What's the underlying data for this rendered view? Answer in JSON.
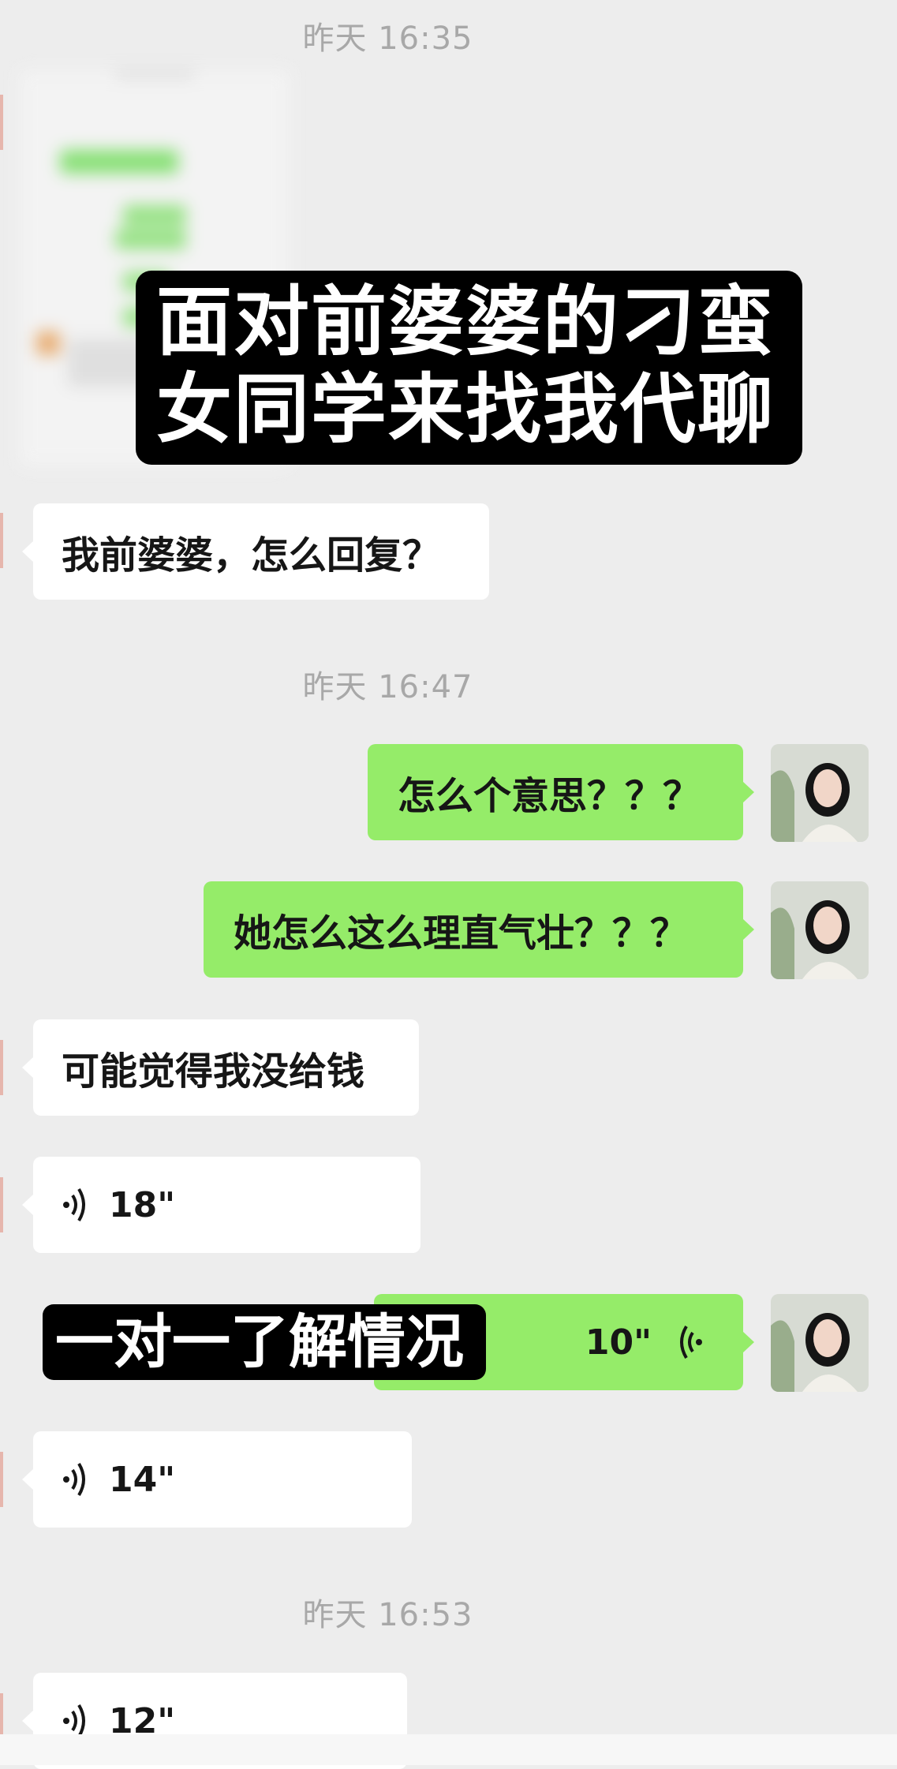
{
  "timestamps": [
    "昨天 16:35",
    "昨天 16:47",
    "昨天 16:53"
  ],
  "overlay_titles": {
    "line1": "面对前婆婆的刁蛮",
    "line2": "女同学来找我代聊",
    "mid": "一对一了解情况"
  },
  "messages": {
    "m1": "我前婆婆，怎么回复？",
    "m2": "怎么个意思？？？",
    "m3": "她怎么这么理直气壮？？？",
    "m4": "可能觉得我没给钱",
    "v1": "18\"",
    "v2": "10\"",
    "v3": "14\"",
    "v4": "12\""
  },
  "icons": {
    "voice_in": "voice-wave-icon",
    "voice_out": "voice-wave-icon"
  },
  "colors": {
    "background": "#ededed",
    "incoming_bubble": "#ffffff",
    "outgoing_bubble": "#95ec69",
    "timestamp": "#a8a8a8",
    "overlay": "#000000"
  }
}
